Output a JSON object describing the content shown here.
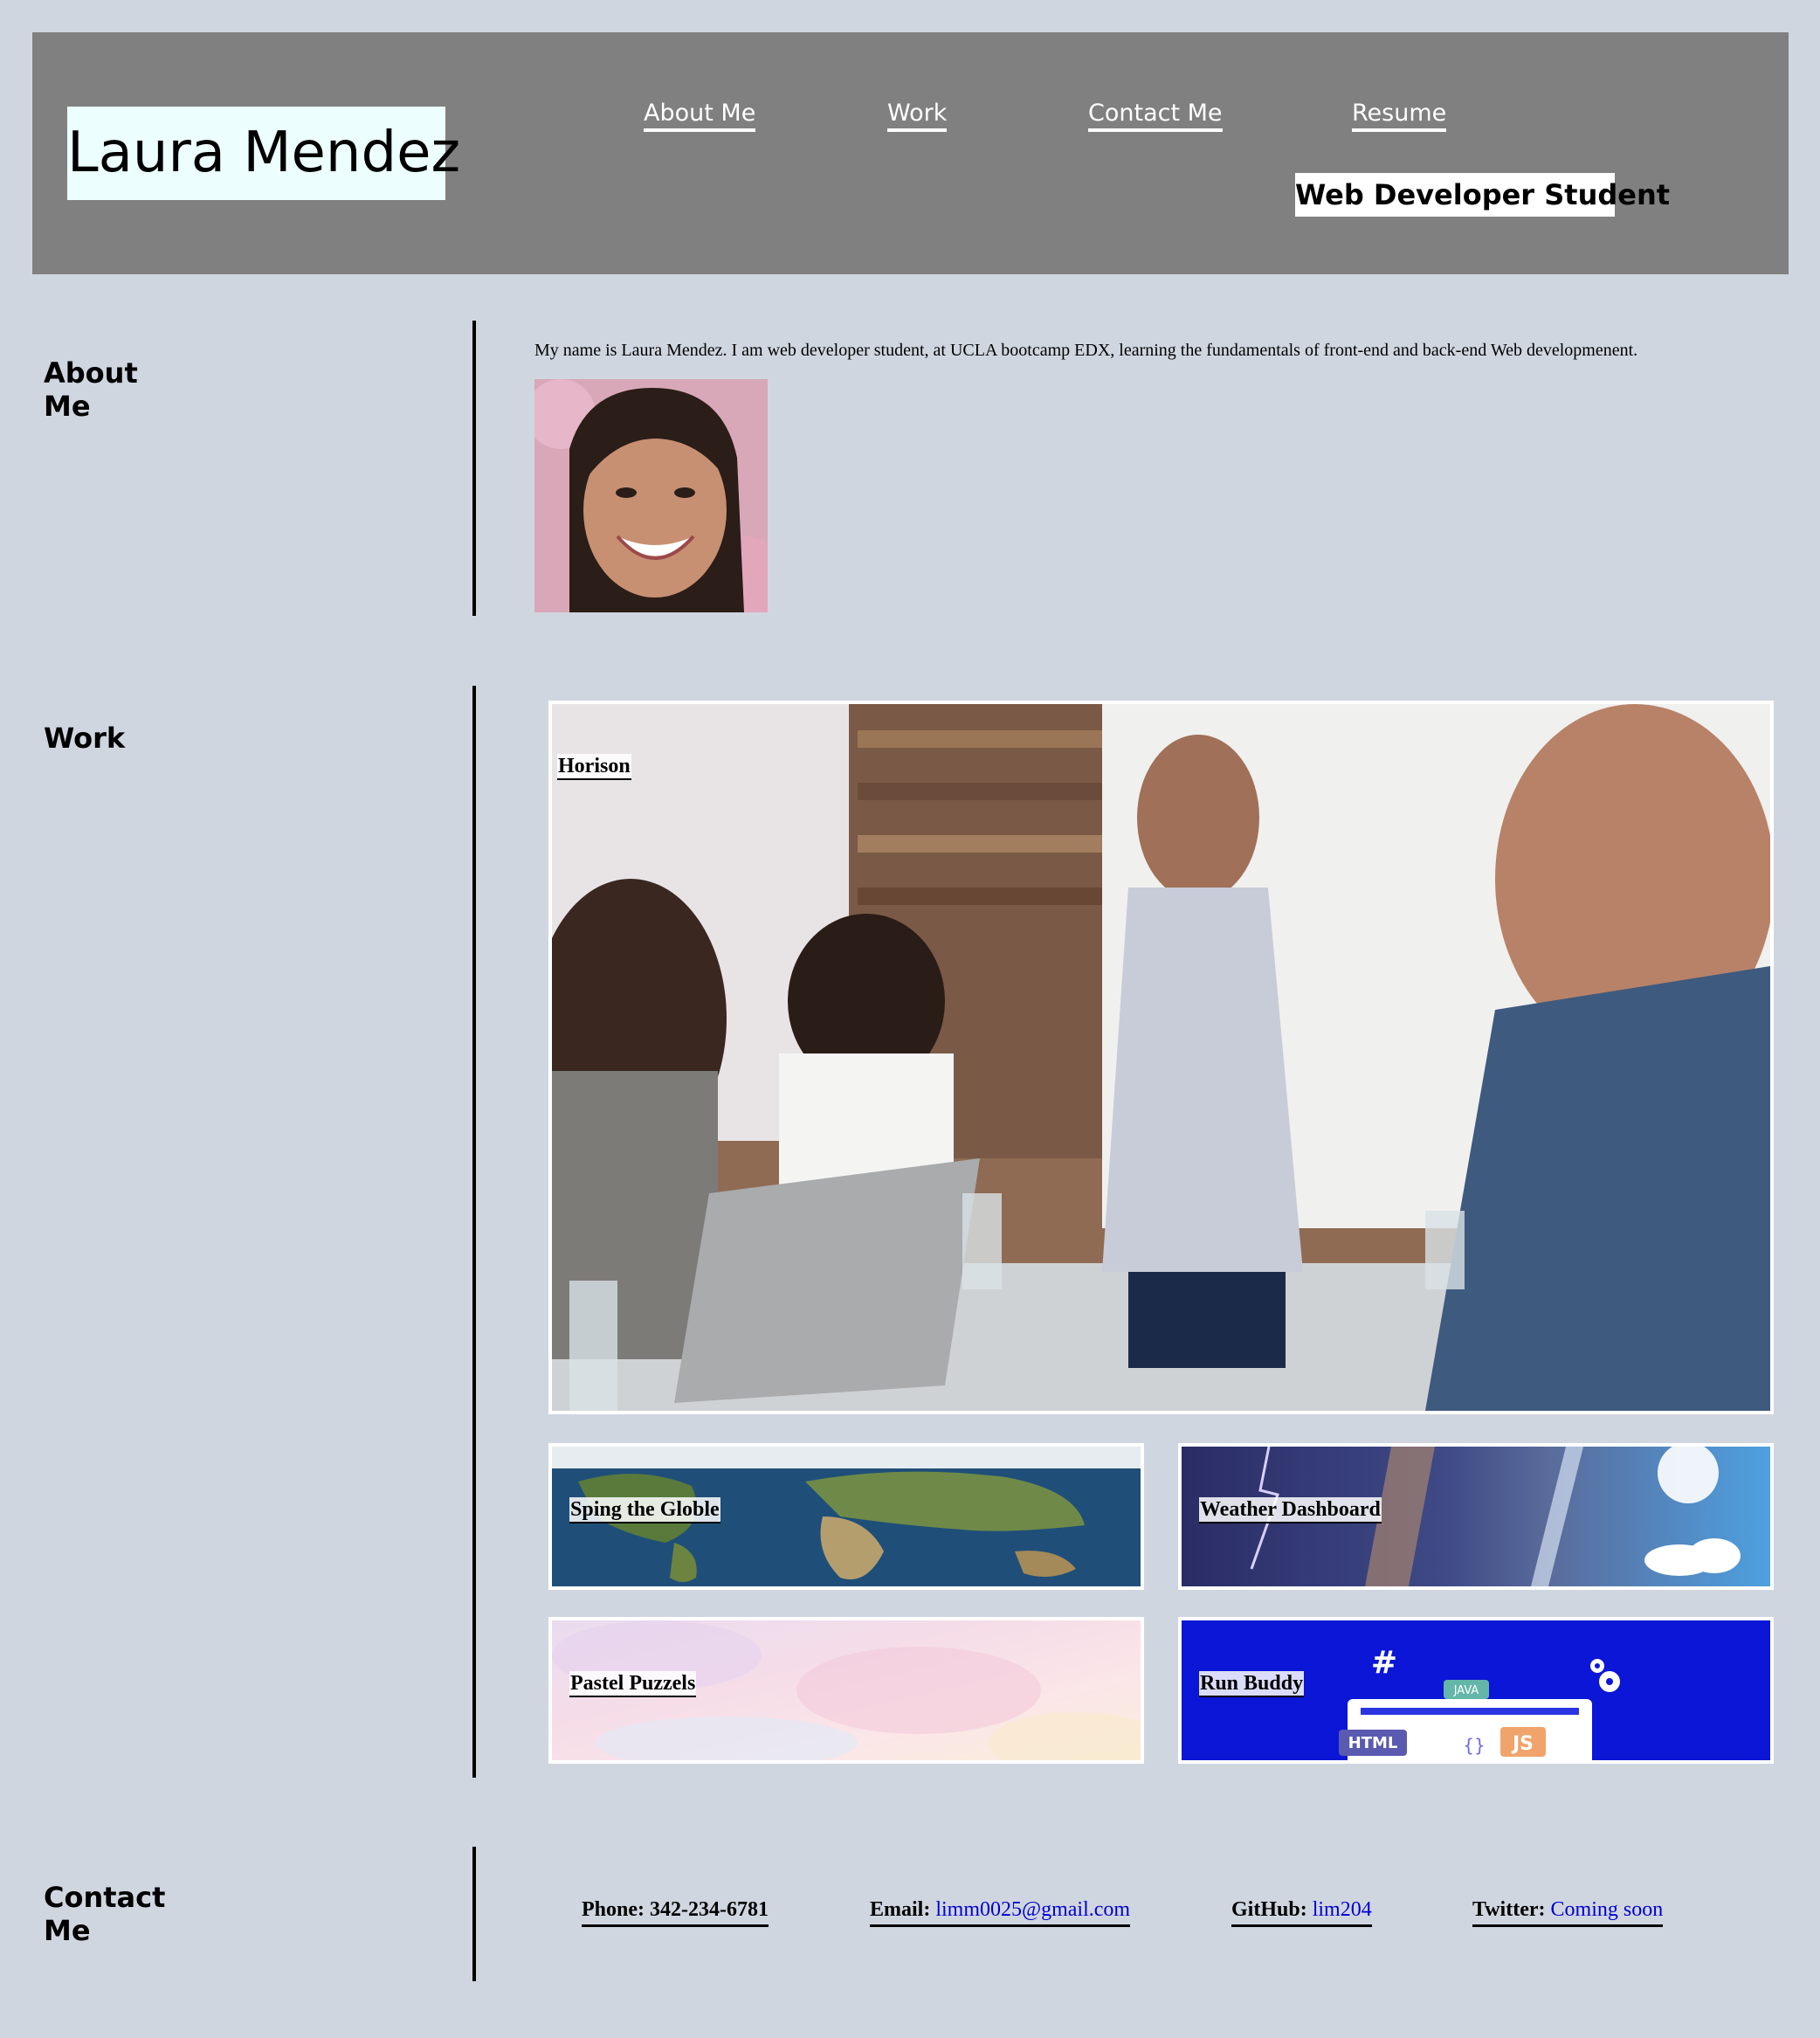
{
  "header": {
    "name": "Laura Mendez",
    "subtitle": "Web Developer Student",
    "nav": [
      {
        "label": "About Me"
      },
      {
        "label": "Work"
      },
      {
        "label": "Contact Me"
      },
      {
        "label": "Resume"
      }
    ]
  },
  "about": {
    "title": "About Me",
    "text": "My name is Laura Mendez. I am web developer student, at UCLA bootcamp EDX, learning the fundamentals of front-end and back-end Web developmenent."
  },
  "work": {
    "title": "Work",
    "projects": [
      {
        "label": "Horison"
      },
      {
        "label": "Sping the Globle"
      },
      {
        "label": "Weather Dashboard"
      },
      {
        "label": "Pastel Puzzels"
      },
      {
        "label": "Run Buddy"
      }
    ],
    "run_buddy_badges": [
      "#",
      "JAVA",
      "HTML",
      "{}",
      "JS"
    ]
  },
  "contact": {
    "title": "Contact Me",
    "items": [
      {
        "label": "Phone:",
        "value": "342-234-6781"
      },
      {
        "label": "Email:",
        "value": "limm0025@gmail.com"
      },
      {
        "label": "GitHub:",
        "value": "lim204"
      },
      {
        "label": "Twitter:",
        "value": "Coming soon"
      }
    ]
  },
  "colors": {
    "page_bg": "#d0d6e0",
    "header_bg": "#808080",
    "logo_bg": "#ecfffe",
    "link": "#0000d0"
  }
}
